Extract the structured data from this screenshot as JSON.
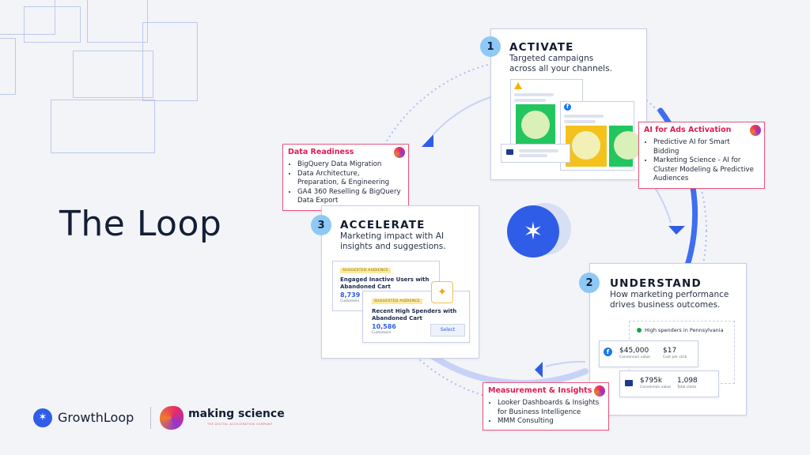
{
  "title": "The Loop",
  "colors": {
    "accent": "#2f5de8",
    "callout_border": "#e5577d",
    "callout_title": "#dd1c52",
    "step_badge": "#8ec9f5"
  },
  "steps": [
    {
      "number": "1",
      "title": "ACTIVATE",
      "desc1": "Targeted campaigns",
      "desc2": "across all your channels."
    },
    {
      "number": "2",
      "title": "UNDERSTAND",
      "desc1": "How marketing performance",
      "desc2": "drives business outcomes."
    },
    {
      "number": "3",
      "title": "ACCELERATE",
      "desc1": "Marketing impact with AI",
      "desc2": "insights and suggestions."
    }
  ],
  "callouts": {
    "data_readiness": {
      "title": "Data Readiness",
      "items": [
        "BigQuery Data Migration",
        "Data Architecture,",
        "Preparation, & Engineering",
        "GA4 360 Reselling & BigQuery",
        "Data Export"
      ]
    },
    "ai_ads": {
      "title": "AI for Ads Activation",
      "items": [
        "Predictive AI for Smart",
        "Bidding",
        "Marketing Science - AI for",
        "Cluster Modeling & Predictive",
        "Audiences"
      ]
    },
    "measurement": {
      "title": "Measurement & Insights",
      "items": [
        "Looker Dashboards & Insights",
        "for Business Intelligence",
        "MMM Consulting"
      ]
    }
  },
  "accelerate_card": {
    "audience1": {
      "badge": "SUGGESTED AUDIENCE",
      "title1": "Engaged Inactive Users with",
      "title2": "Abandoned Cart",
      "count": "8,739",
      "sub": "Customers"
    },
    "audience2": {
      "badge": "SUGGESTED AUDIENCE",
      "title1": "Recent High Spenders with",
      "title2": "Abandoned Cart",
      "count": "10,586",
      "sub": "Customers",
      "button": "Select"
    }
  },
  "understand_card": {
    "segment": "High spenders in Pennsylvania",
    "row1": {
      "value1": "$45,000",
      "sub1": "Conversion value",
      "value2": "$17",
      "sub2": "Cost per click"
    },
    "row2": {
      "value1": "$795k",
      "sub1": "Conversion value",
      "value2": "1,098",
      "sub2": "Total clicks"
    }
  },
  "footer": {
    "brand1": "GrowthLoop",
    "brand2": "making science",
    "brand2_tagline": "THE DIGITAL ACCELERATION COMPANY"
  },
  "icons": [
    "google-ads-icon",
    "facebook-icon",
    "email-icon",
    "person-icon",
    "sparkle-icon",
    "growthloop-logo-icon",
    "making-science-logo-icon"
  ]
}
